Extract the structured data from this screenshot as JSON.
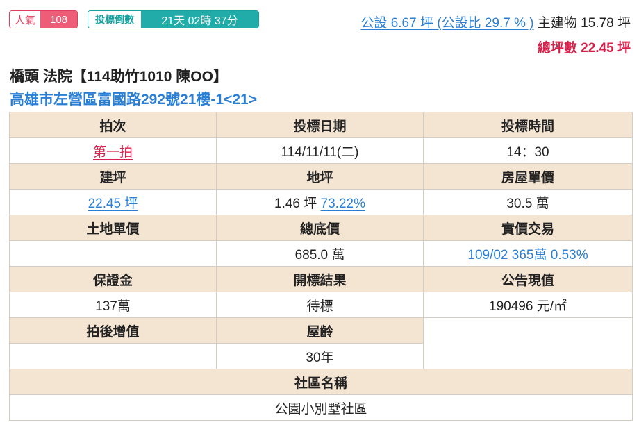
{
  "badges": {
    "popularity_label": "人氣",
    "popularity_value": "108",
    "countdown_label": "投標倒數",
    "countdown_value": "21天 02時 37分"
  },
  "area": {
    "public_area": "公設 6.67 坪 (公設比 29.7 % )",
    "main_building": "主建物 15.78 坪",
    "total": "總坪數 22.45 坪"
  },
  "listing": {
    "title": "橋頭 法院【114助竹1010 陳OO】",
    "address": "高雄市左營區富國路292號21樓-1<21>"
  },
  "table": {
    "h_round": "拍次",
    "v_round": "第一拍",
    "h_bid_date": "投標日期",
    "v_bid_date": "114/11/11(二)",
    "h_bid_time": "投標時間",
    "v_bid_time": "14：30",
    "h_building_area": "建坪",
    "v_building_area": "22.45 坪",
    "h_land_area": "地坪",
    "v_land_area": "1.46 坪",
    "v_land_ratio": "73.22%",
    "h_house_unit_price": "房屋單價",
    "v_house_unit_price": "30.5 萬",
    "h_land_unit_price": "土地單價",
    "v_land_unit_price": "",
    "h_reserve_price": "總底價",
    "v_reserve_price": "685.0 萬",
    "h_actual_price": "實價交易",
    "v_actual_price": "109/02 365萬 0.53%",
    "h_deposit": "保證金",
    "v_deposit": "137萬",
    "h_result": "開標結果",
    "v_result": "待標",
    "h_announced_value": "公告現值",
    "v_announced_value": "190496 元/㎡",
    "h_appreciation": "拍後增值",
    "v_appreciation": "",
    "h_building_age": "屋齡",
    "v_building_age": "30年",
    "h_community": "社區名稱",
    "v_community": "公園小別墅社區"
  },
  "colors": {
    "accent_blue": "#2a7fd4",
    "accent_red": "#d6214a",
    "teal": "#22aca9",
    "pink": "#ed5d78",
    "header_bg": "#f4e4d2"
  }
}
